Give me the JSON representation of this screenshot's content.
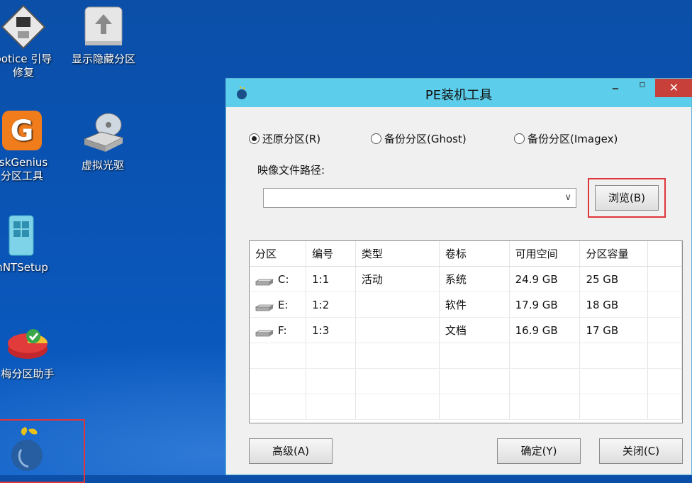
{
  "desktop": {
    "icons": [
      {
        "label": "ootice 引导\n修复",
        "icon": "floppy-icon"
      },
      {
        "label": "显示隐藏分区",
        "icon": "drive-arrow-icon"
      },
      {
        "label": "iskGenius\n分区工具",
        "icon": "diskgenius-icon"
      },
      {
        "label": "虚拟光驱",
        "icon": "optical-drive-icon"
      },
      {
        "label": "inNTSetup",
        "icon": "winntsetup-icon"
      },
      {
        "label": "梅分区助手",
        "icon": "partition-assistant-icon"
      }
    ]
  },
  "window": {
    "title": "PE装机工具",
    "controls": {
      "minimize": "‒",
      "maximize": "▫",
      "close": "✕"
    },
    "modes": [
      {
        "label": "还原分区(R)",
        "checked": true
      },
      {
        "label": "备份分区(Ghost)",
        "checked": false
      },
      {
        "label": "备份分区(Imagex)",
        "checked": false
      }
    ],
    "path_label": "映像文件路径:",
    "path_value": "",
    "browse_label": "浏览(B)",
    "table": {
      "columns": [
        "分区",
        "编号",
        "类型",
        "卷标",
        "可用空间",
        "分区容量"
      ],
      "rows": [
        {
          "drive": "C:",
          "num": "1:1",
          "type": "活动",
          "label": "系统",
          "free": "24.9 GB",
          "size": "25 GB"
        },
        {
          "drive": "E:",
          "num": "1:2",
          "type": "",
          "label": "软件",
          "free": "17.9 GB",
          "size": "18 GB"
        },
        {
          "drive": "F:",
          "num": "1:3",
          "type": "",
          "label": "文档",
          "free": "16.9 GB",
          "size": "17 GB"
        }
      ]
    },
    "buttons": {
      "advanced": "高级(A)",
      "ok": "确定(Y)",
      "close": "关闭(C)"
    }
  },
  "colors": {
    "titlebar": "#5ccdea",
    "close": "#c7413a",
    "highlight": "#e0353a",
    "desktop": "#0b54b5"
  }
}
